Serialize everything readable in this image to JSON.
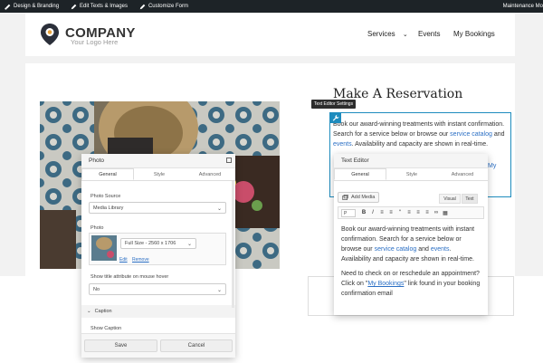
{
  "admin_bar": {
    "items": [
      {
        "label": "Design & Branding",
        "icon": "brush-icon"
      },
      {
        "label": "Edit Texts & Images",
        "icon": "pencil-icon"
      },
      {
        "label": "Customize Form",
        "icon": "pencil-icon"
      }
    ],
    "right_label": "Maintenance Mo"
  },
  "header": {
    "logo_title": "COMPANY",
    "logo_subtitle": "Your Logo Here",
    "nav": [
      {
        "label": "Services",
        "has_dropdown": true
      },
      {
        "label": "Events"
      },
      {
        "label": "My Bookings"
      }
    ]
  },
  "main": {
    "heading": "Make A Reservation",
    "paragraph_prefix": "Book our award-winning treatments with instant confirmation. Search for a service below or browse our ",
    "link_catalog": "service catalog",
    "paragraph_and": " and ",
    "link_events": "events",
    "paragraph_suffix": ". Availability and capacity are shown in real-time.",
    "partial_link": "My"
  },
  "tooltip": {
    "label": "Text Editor Settings"
  },
  "photo_panel": {
    "title": "Photo",
    "tabs": [
      "General",
      "Style",
      "Advanced"
    ],
    "photo_source_label": "Photo Source",
    "photo_source_value": "Media Library",
    "photo_label": "Photo",
    "size_value": "Full Size - 2560 x 1706",
    "edit_link": "Edit",
    "remove_link": "Remove",
    "title_attr_label": "Show title attribute on mouse hover",
    "title_attr_value": "No",
    "caption_section": "Caption",
    "show_caption_label": "Show Caption",
    "save_label": "Save",
    "cancel_label": "Cancel"
  },
  "text_editor_panel": {
    "title": "Text Editor",
    "tabs": [
      "General",
      "Style",
      "Advanced"
    ],
    "add_media_label": "Add Media",
    "mode_visual": "Visual",
    "mode_text": "Text",
    "format_select": "P",
    "toolbar_icons": [
      "bold-icon",
      "italic-icon",
      "bullet-list-icon",
      "numbered-list-icon",
      "blockquote-icon",
      "align-left-icon",
      "align-center-icon",
      "align-right-icon",
      "link-icon",
      "toolbar-toggle-icon"
    ],
    "content_p1_prefix": "Book our award-winning treatments with instant confirmation. Search for a service below or browse our ",
    "content_p1_link1": "service catalog",
    "content_p1_and": " and ",
    "content_p1_link2": "events",
    "content_p1_suffix": ". Availability and capacity are shown in real-time.",
    "content_p2_prefix": "Need to check on or reschedule an appointment? Click on \"",
    "content_p2_link": "My Bookings",
    "content_p2_suffix": "\" link found in your booking confirmation email"
  },
  "colors": {
    "admin_bg": "#1d2327",
    "accent_blue": "#2b6fc4",
    "selection_border": "#1e8cbe"
  }
}
